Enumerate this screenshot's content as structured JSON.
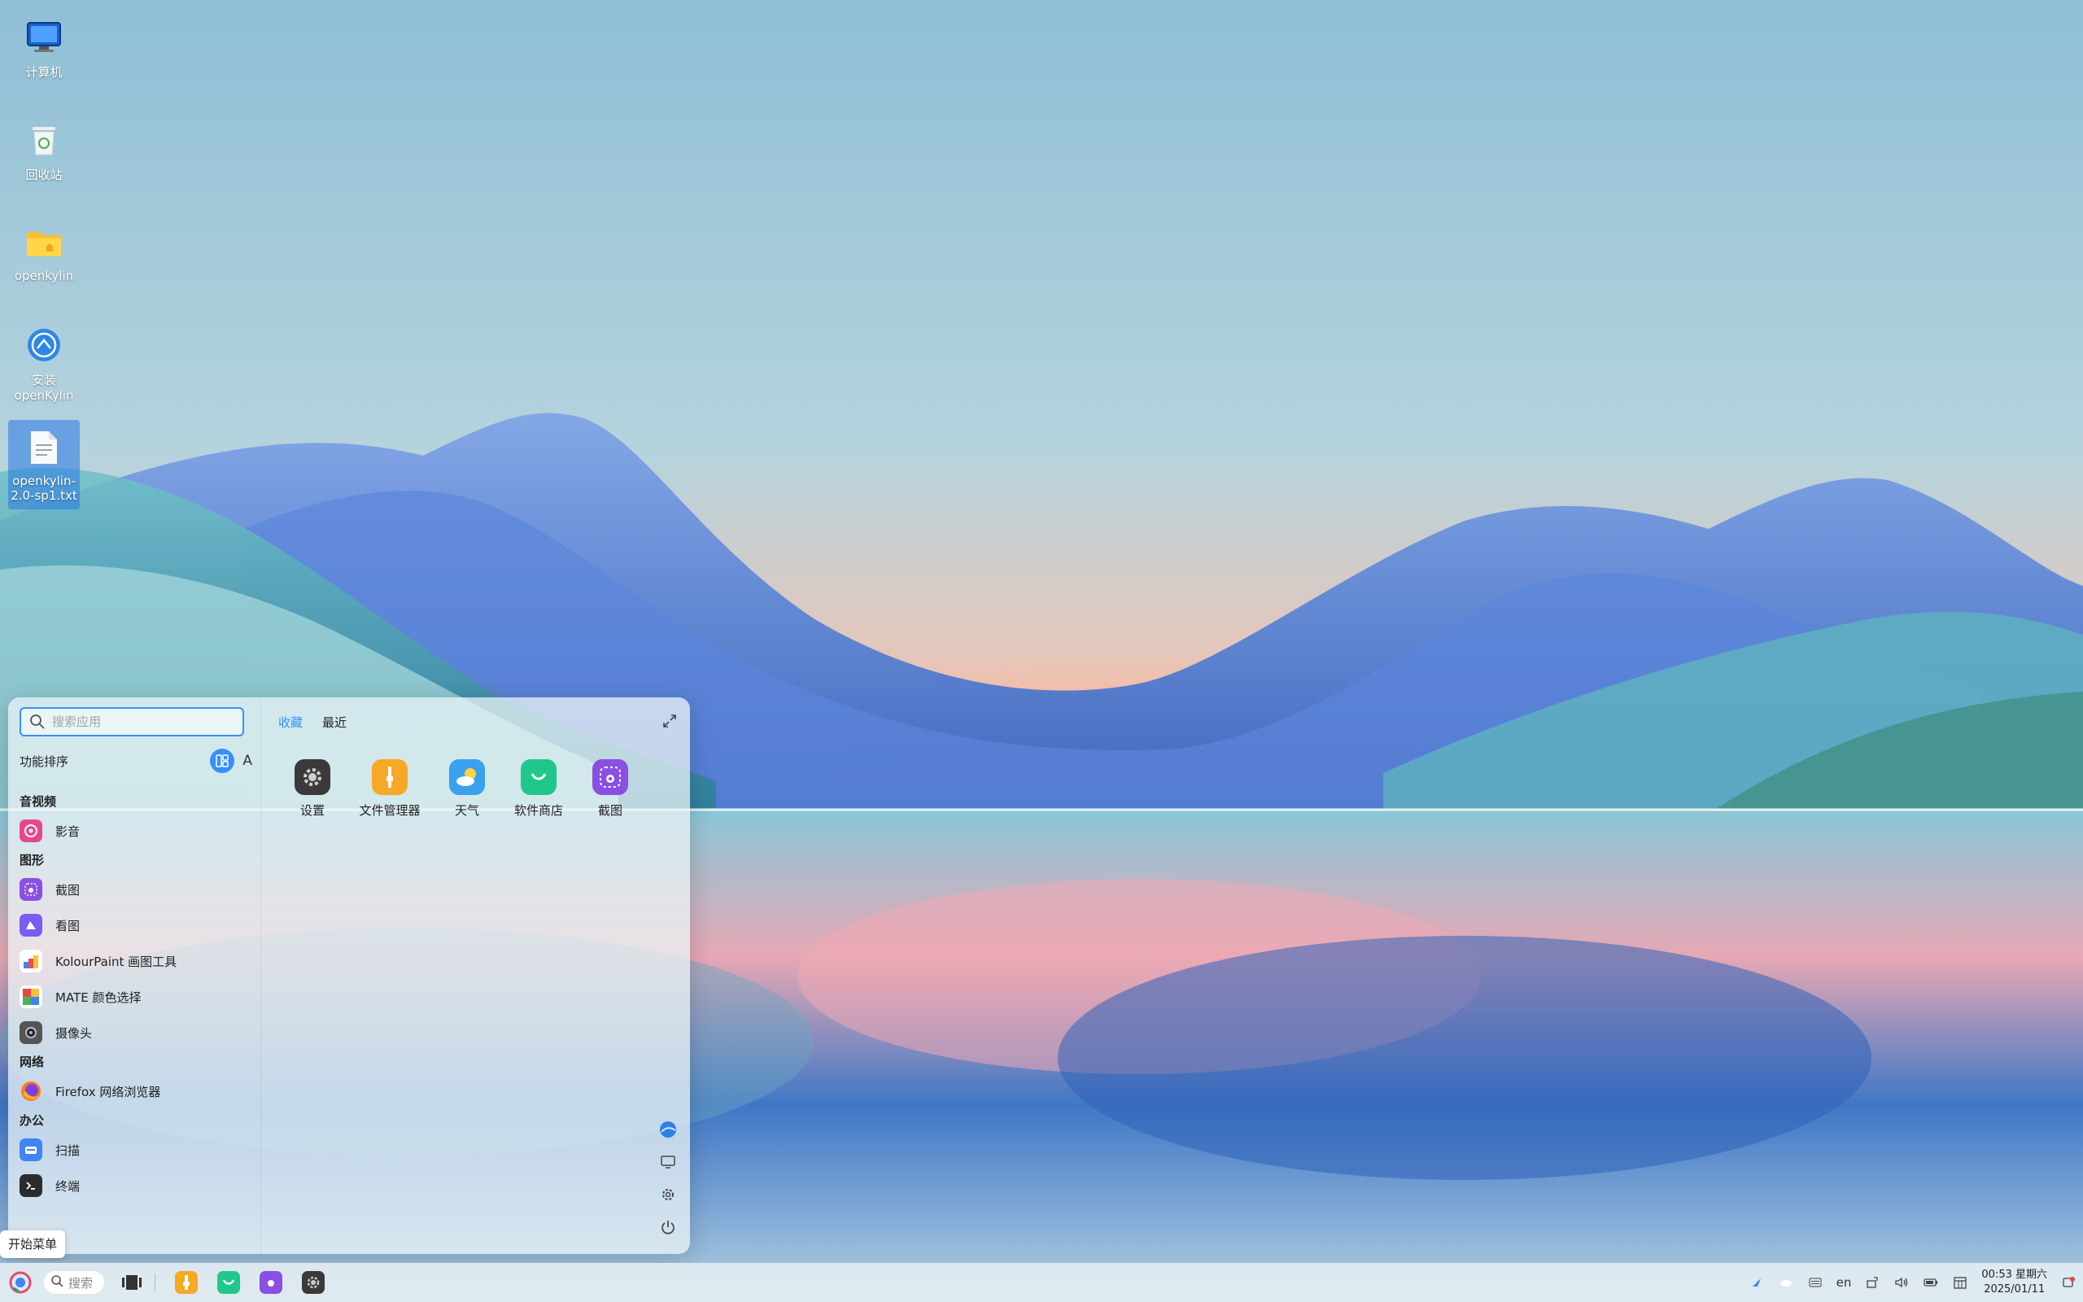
{
  "desktop": {
    "icons": [
      {
        "label": "计算机"
      },
      {
        "label": "回收站"
      },
      {
        "label": "openkylin"
      },
      {
        "label": "安装\nopenKylin"
      },
      {
        "label": "openkylin-2.0-sp1.txt"
      }
    ]
  },
  "start_menu": {
    "search_placeholder": "搜索应用",
    "sort_label": "功能排序",
    "sort_alpha": "A",
    "tabs": [
      {
        "label": "收藏",
        "active": true
      },
      {
        "label": "最近",
        "active": false
      }
    ],
    "categories": [
      {
        "name": "音视频",
        "apps": [
          {
            "label": "影音"
          }
        ]
      },
      {
        "name": "图形",
        "apps": [
          {
            "label": "截图"
          },
          {
            "label": "看图"
          },
          {
            "label": "KolourPaint 画图工具"
          },
          {
            "label": "MATE 颜色选择"
          },
          {
            "label": "摄像头"
          }
        ]
      },
      {
        "name": "网络",
        "apps": [
          {
            "label": "Firefox 网络浏览器"
          }
        ]
      },
      {
        "name": "办公",
        "apps": [
          {
            "label": "扫描"
          },
          {
            "label": "终端"
          }
        ]
      }
    ],
    "favorites": [
      {
        "label": "设置",
        "icon": "settings-icon"
      },
      {
        "label": "文件管理器",
        "icon": "file-manager-icon"
      },
      {
        "label": "天气",
        "icon": "weather-icon"
      },
      {
        "label": "软件商店",
        "icon": "software-store-icon"
      },
      {
        "label": "截图",
        "icon": "screenshot-icon"
      }
    ]
  },
  "tooltip": {
    "text": "开始菜单"
  },
  "taskbar": {
    "search_label": "搜索",
    "tray_lang": "en",
    "clock_time": "00:53 星期六",
    "clock_date": "2025/01/11"
  },
  "colors": {
    "accent": "#3790fa"
  }
}
